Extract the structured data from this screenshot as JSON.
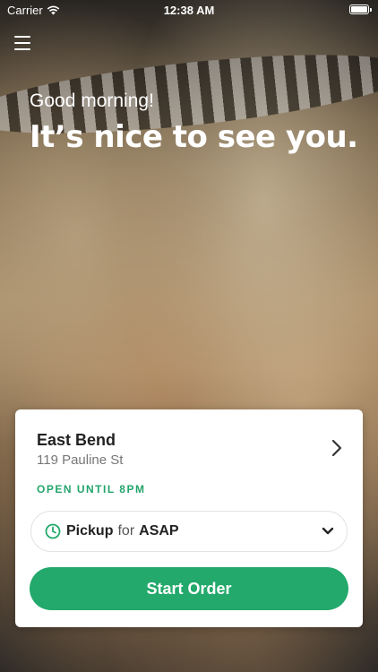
{
  "status_bar": {
    "carrier": "Carrier",
    "time": "12:38 AM"
  },
  "header": {
    "greeting": "Good morning!",
    "headline": "It’s nice to see you."
  },
  "store": {
    "name": "East Bend",
    "address": "119 Pauline St",
    "open_status": "OPEN UNTIL 8PM"
  },
  "order_mode": {
    "mode": "Pickup",
    "connector": "for",
    "time": "ASAP"
  },
  "cta": {
    "label": "Start Order"
  },
  "colors": {
    "accent": "#22a96b",
    "open_text": "#24a46c"
  },
  "icons": [
    "wifi-icon",
    "battery-icon",
    "hamburger-menu-icon",
    "chevron-right-icon",
    "clock-icon",
    "chevron-down-icon"
  ]
}
